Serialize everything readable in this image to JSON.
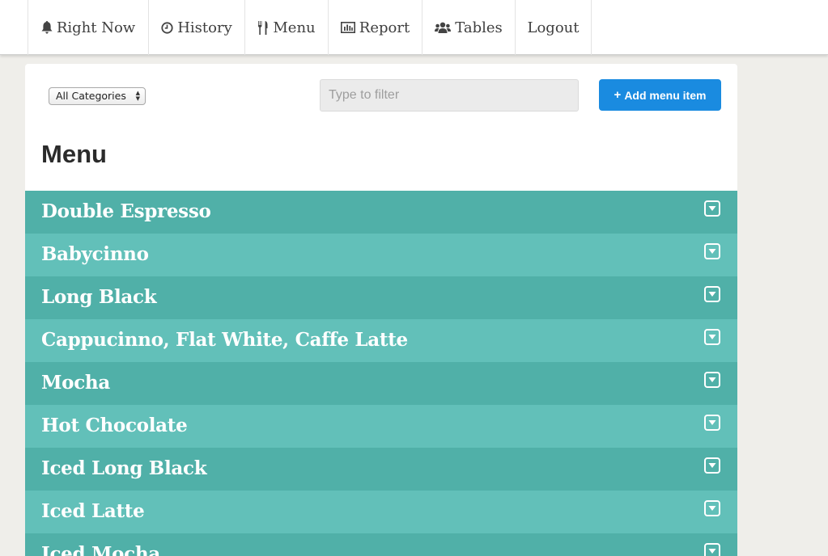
{
  "nav": {
    "items": [
      {
        "label": "Right Now",
        "icon": "bell-icon"
      },
      {
        "label": "History",
        "icon": "clock-icon"
      },
      {
        "label": "Menu",
        "icon": "cutlery-icon"
      },
      {
        "label": "Report",
        "icon": "bar-chart-icon"
      },
      {
        "label": "Tables",
        "icon": "group-icon"
      },
      {
        "label": "Logout",
        "icon": ""
      }
    ]
  },
  "toolbar": {
    "category_select": "All Categories",
    "filter_placeholder": "Type to filter",
    "add_button_label": "Add menu item"
  },
  "page": {
    "title": "Menu"
  },
  "menu_items": [
    "Double Espresso",
    "Babycinno",
    "Long Black",
    "Cappucinno, Flat White, Caffe Latte",
    "Mocha",
    "Hot Chocolate",
    "Iced Long Black",
    "Iced Latte",
    "Iced Mocha"
  ],
  "colors": {
    "row_dark": "#50b0a8",
    "row_light": "#62c0b9",
    "accent_button": "#1a8be0",
    "background": "#efeeea"
  }
}
